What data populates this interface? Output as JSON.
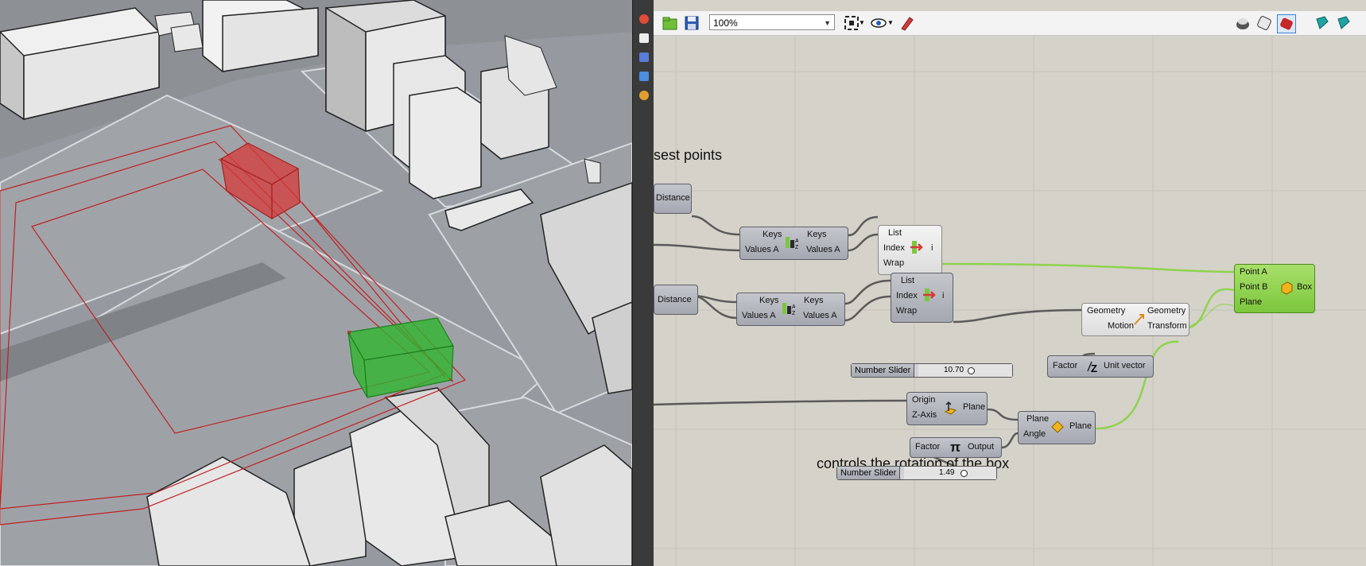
{
  "toolbar": {
    "zoom_value": "100%",
    "icons": [
      "open-file-icon",
      "save-icon",
      "zoom-extents-icon",
      "preview-eye-icon",
      "sketch-pen-icon",
      "preview-shaded-icon",
      "preview-wire-icon",
      "preview-selected-icon",
      "bake-icon",
      "bake-2-icon"
    ]
  },
  "canvas": {
    "group_title_partial": "sest points",
    "note_rotation": "controls the rotation of the box"
  },
  "components": {
    "distance_1": {
      "label": "Distance"
    },
    "distance_2": {
      "label": "Distance"
    },
    "sort_1": {
      "in_keys": "Keys",
      "in_values": "Values A",
      "out_keys": "Keys",
      "out_values": "Values A"
    },
    "sort_2": {
      "in_keys": "Keys",
      "in_values": "Values A",
      "out_keys": "Keys",
      "out_values": "Values A"
    },
    "list_1": {
      "in_list": "List",
      "in_index": "Index",
      "in_wrap": "Wrap",
      "out": "i"
    },
    "list_2": {
      "in_list": "List",
      "in_index": "Index",
      "in_wrap": "Wrap",
      "out": "i"
    },
    "move": {
      "in_geometry": "Geometry",
      "in_motion": "Motion",
      "out_geometry": "Geometry",
      "out_transform": "Transform"
    },
    "unit_z": {
      "in_factor": "Factor",
      "out": "Unit vector"
    },
    "plane": {
      "in_origin": "Origin",
      "in_zaxis": "Z-Axis",
      "out": "Plane"
    },
    "rotate": {
      "in_plane": "Plane",
      "in_angle": "Angle",
      "out": "Plane"
    },
    "pi": {
      "in_factor": "Factor",
      "out": "Output"
    },
    "box": {
      "in_a": "Point A",
      "in_b": "Point B",
      "in_plane": "Plane",
      "out": "Box"
    }
  },
  "sliders": {
    "slider_1": {
      "name": "Number Slider",
      "value": "10.70"
    },
    "slider_2": {
      "name": "Number Slider",
      "value": "1.49"
    }
  },
  "colors": {
    "canvas_bg": "#d5d2c9",
    "component": "#b3b5bc",
    "box_component": "#8fd34e",
    "wire": "#5a5a5a",
    "wire_selected": "#8fd34e",
    "red_box": "#d63a3a",
    "green_box": "#2fb52f"
  }
}
